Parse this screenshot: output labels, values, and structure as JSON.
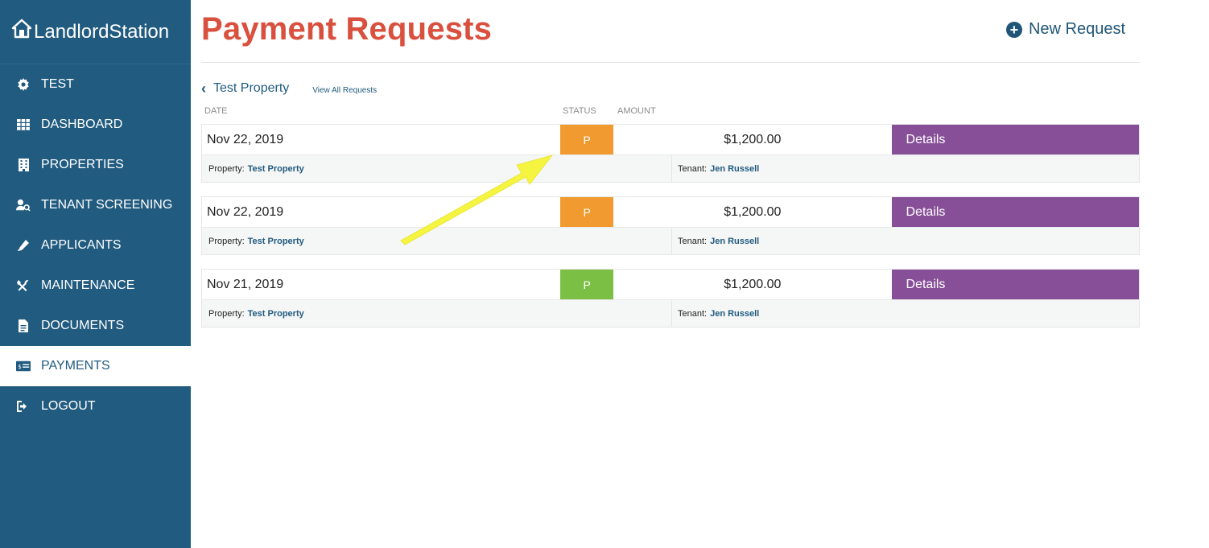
{
  "brand": {
    "name": "LandlordStation"
  },
  "sidebar": {
    "items": [
      {
        "label": "TEST",
        "icon": "gear-icon"
      },
      {
        "label": "DASHBOARD",
        "icon": "grid-icon"
      },
      {
        "label": "PROPERTIES",
        "icon": "building-icon"
      },
      {
        "label": "TENANT SCREENING",
        "icon": "user-search-icon"
      },
      {
        "label": "APPLICANTS",
        "icon": "pen-icon"
      },
      {
        "label": "MAINTENANCE",
        "icon": "tools-icon"
      },
      {
        "label": "DOCUMENTS",
        "icon": "file-icon"
      },
      {
        "label": "PAYMENTS",
        "icon": "payment-card-icon",
        "active": true
      },
      {
        "label": "LOGOUT",
        "icon": "logout-icon"
      }
    ]
  },
  "header": {
    "title": "Payment Requests",
    "new_request_label": "New Request"
  },
  "breadcrumb": {
    "back_label": "Test Property",
    "view_all_label": "View All Requests"
  },
  "columns": {
    "date": "DATE",
    "status": "STATUS",
    "amount": "AMOUNT"
  },
  "requests": [
    {
      "date": "Nov 22, 2019",
      "status": "P",
      "status_color": "#f09a2f",
      "amount": "$1,200.00",
      "details_label": "Details",
      "property_label": "Property:",
      "property": "Test Property",
      "tenant_label": "Tenant:",
      "tenant": "Jen Russell"
    },
    {
      "date": "Nov 22, 2019",
      "status": "P",
      "status_color": "#f09a2f",
      "amount": "$1,200.00",
      "details_label": "Details",
      "property_label": "Property:",
      "property": "Test Property",
      "tenant_label": "Tenant:",
      "tenant": "Jen Russell"
    },
    {
      "date": "Nov 21, 2019",
      "status": "P",
      "status_color": "#7cbf45",
      "amount": "$1,200.00",
      "details_label": "Details",
      "property_label": "Property:",
      "property": "Test Property",
      "tenant_label": "Tenant:",
      "tenant": "Jen Russell"
    }
  ],
  "colors": {
    "sidebar": "#215b7f",
    "title": "#d9503e",
    "details": "#884f99",
    "annotation_arrow": "#f5f541"
  }
}
